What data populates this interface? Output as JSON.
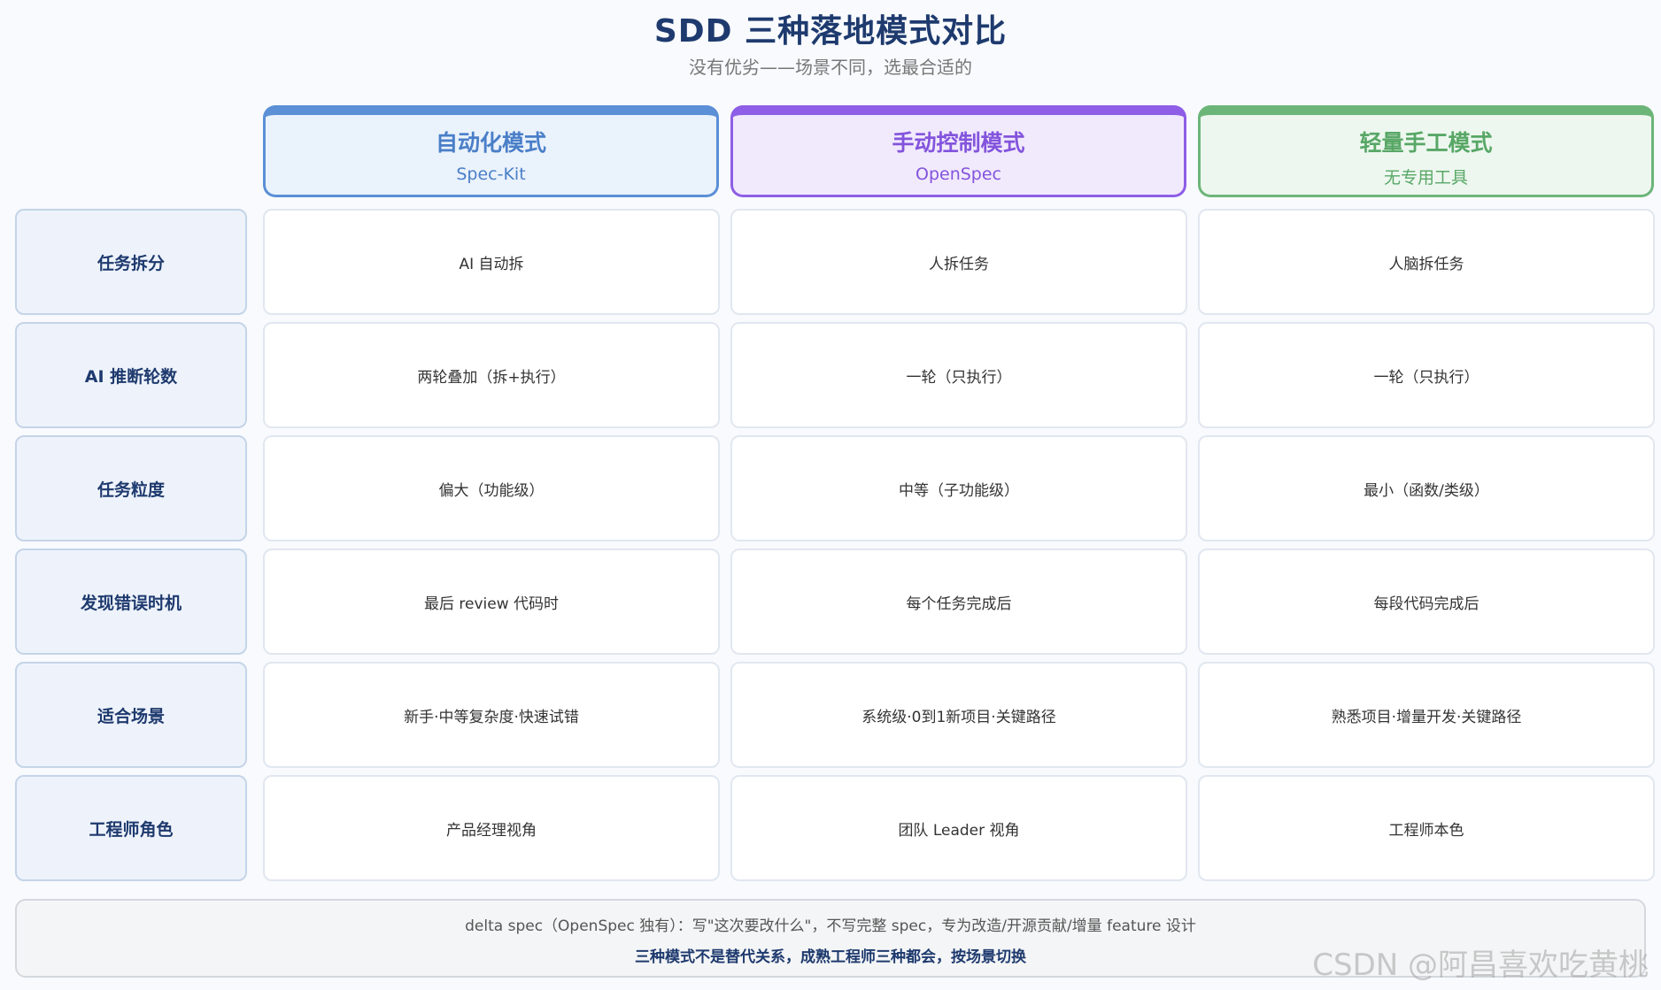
{
  "title": "SDD 三种落地模式对比",
  "subtitle": "没有优劣——场景不同，选最合适的",
  "columns": [
    {
      "name": "自动化模式",
      "tool": "Spec-Kit",
      "color": "#5b8fd6"
    },
    {
      "name": "手动控制模式",
      "tool": "OpenSpec",
      "color": "#8e5ee6"
    },
    {
      "name": "轻量手工模式",
      "tool": "无专用工具",
      "color": "#6cb579"
    }
  ],
  "rows": [
    {
      "label": "任务拆分",
      "cells": [
        "AI 自动拆",
        "人拆任务",
        "人脑拆任务"
      ]
    },
    {
      "label": "AI 推断轮数",
      "cells": [
        "两轮叠加（拆+执行）",
        "一轮（只执行）",
        "一轮（只执行）"
      ]
    },
    {
      "label": "任务粒度",
      "cells": [
        "偏大（功能级）",
        "中等（子功能级）",
        "最小（函数/类级）"
      ]
    },
    {
      "label": "发现错误时机",
      "cells": [
        "最后 review 代码时",
        "每个任务完成后",
        "每段代码完成后"
      ]
    },
    {
      "label": "适合场景",
      "cells": [
        "新手·中等复杂度·快速试错",
        "系统级·0到1新项目·关键路径",
        "熟悉项目·增量开发·关键路径"
      ]
    },
    {
      "label": "工程师角色",
      "cells": [
        "产品经理视角",
        "团队 Leader 视角",
        "工程师本色"
      ]
    }
  ],
  "note": {
    "line1": "delta spec（OpenSpec 独有）：写\"这次要改什么\"，不写完整 spec，专为改造/开源贡献/增量 feature 设计",
    "line2": "三种模式不是替代关系，成熟工程师三种都会，按场景切换"
  },
  "watermark": "CSDN @阿昌喜欢吃黄桃"
}
